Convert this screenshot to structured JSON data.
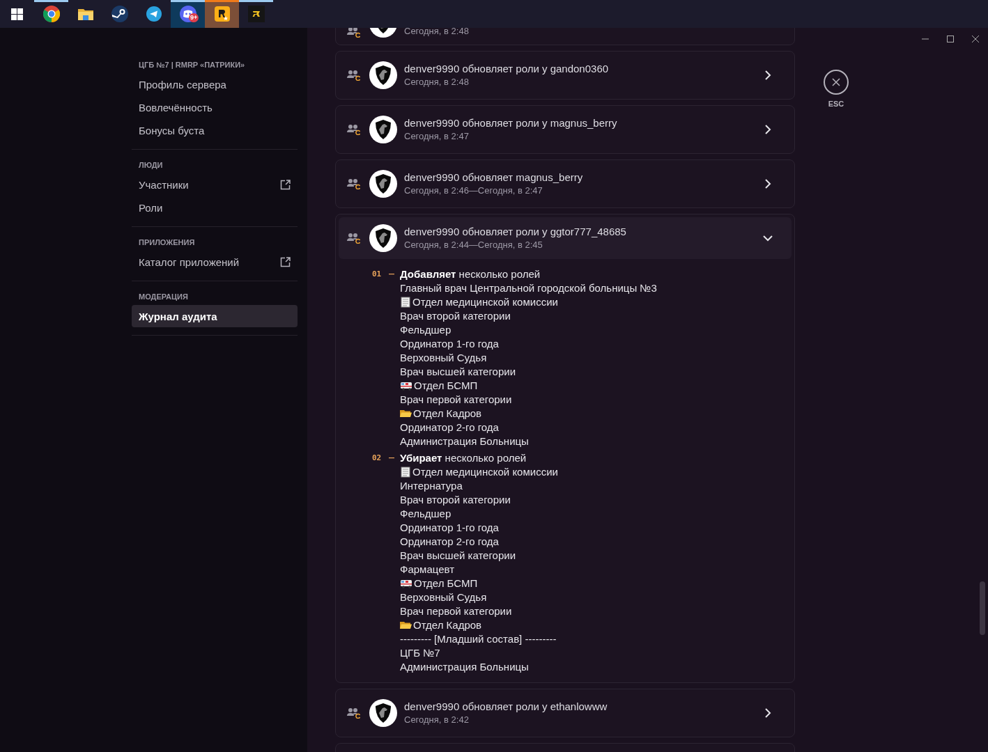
{
  "taskbar": {
    "apps": [
      {
        "kind": "windows",
        "open": false,
        "selected": false
      },
      {
        "kind": "chrome",
        "open": true,
        "selected": false
      },
      {
        "kind": "folder",
        "open": false,
        "selected": false
      },
      {
        "kind": "steam",
        "open": false,
        "selected": false
      },
      {
        "kind": "telegram",
        "open": false,
        "selected": false
      },
      {
        "kind": "discord",
        "open": true,
        "selected": true,
        "badge": "9+"
      },
      {
        "kind": "rockstar",
        "open": true,
        "selected": true
      },
      {
        "kind": "r-app",
        "open": true,
        "selected": false
      }
    ]
  },
  "sidebar": {
    "sections": [
      {
        "header": "ЦГБ №7 | RMRP «ПАТРИКИ»",
        "items": [
          {
            "label": "Профиль сервера",
            "selected": false,
            "external": false
          },
          {
            "label": "Вовлечённость",
            "selected": false,
            "external": false
          },
          {
            "label": "Бонусы буста",
            "selected": false,
            "external": false
          }
        ]
      },
      {
        "header": "ЛЮДИ",
        "items": [
          {
            "label": "Участники",
            "selected": false,
            "external": true
          },
          {
            "label": "Роли",
            "selected": false,
            "external": false
          }
        ]
      },
      {
        "header": "ПРИЛОЖЕНИЯ",
        "items": [
          {
            "label": "Каталог приложений",
            "selected": false,
            "external": true
          }
        ]
      },
      {
        "header": "МОДЕРАЦИЯ",
        "items": [
          {
            "label": "Журнал аудита",
            "selected": true,
            "external": false
          }
        ]
      }
    ]
  },
  "audit_log": {
    "entries": [
      {
        "time": "Сегодня, в 2:48"
      },
      {
        "title": "denver9990 обновляет роли у gandon0360",
        "time": "Сегодня, в 2:48",
        "expanded": false
      },
      {
        "title": "denver9990 обновляет роли у magnus_berry",
        "time": "Сегодня, в 2:47",
        "expanded": false
      },
      {
        "title": "denver9990 обновляет magnus_berry",
        "time": "Сегодня, в 2:46—Сегодня, в 2:47",
        "expanded": false
      },
      {
        "title": "denver9990 обновляет роли у ggtor777_48685",
        "time": "Сегодня, в 2:44—Сегодня, в 2:45",
        "expanded": true,
        "changes": [
          {
            "number": "01",
            "action": "**Добавляет** несколько ролей",
            "roles": [
              {
                "name": "Главный врач Центральной городской больницы №3",
                "kind": "plain"
              },
              {
                "name": "Отдел медицинской комиссии",
                "kind": "document"
              },
              {
                "name": "Врач второй категории",
                "kind": "plain"
              },
              {
                "name": "Фельдшер",
                "kind": "plain"
              },
              {
                "name": "Ординатор 1-го года",
                "kind": "plain"
              },
              {
                "name": "Верховный Судья",
                "kind": "plain"
              },
              {
                "name": "Врач высшей категории",
                "kind": "plain"
              },
              {
                "name": "Отдел БСМП",
                "kind": "ambulance"
              },
              {
                "name": "Врач первой категории",
                "kind": "plain"
              },
              {
                "name": "Отдел Кадров",
                "kind": "folder"
              },
              {
                "name": "Ординатор 2-го года",
                "kind": "plain"
              },
              {
                "name": "Администрация Больницы",
                "kind": "plain"
              }
            ]
          },
          {
            "number": "02",
            "action": "**Убирает** несколько ролей",
            "roles": [
              {
                "name": "Отдел медицинской комиссии",
                "kind": "document"
              },
              {
                "name": "Интернатура",
                "kind": "plain"
              },
              {
                "name": "Врач второй категории",
                "kind": "plain"
              },
              {
                "name": "Фельдшер",
                "kind": "plain"
              },
              {
                "name": "Ординатор 1-го года",
                "kind": "plain"
              },
              {
                "name": "Ординатор 2-го года",
                "kind": "plain"
              },
              {
                "name": "Врач высшей категории",
                "kind": "plain"
              },
              {
                "name": "Фармацевт",
                "kind": "plain"
              },
              {
                "name": "Отдел БСМП",
                "kind": "ambulance"
              },
              {
                "name": "Верховный Судья",
                "kind": "plain"
              },
              {
                "name": "Врач первой категории",
                "kind": "plain"
              },
              {
                "name": "Отдел Кадров",
                "kind": "folder"
              },
              {
                "name": "--------- [Младший состав] ---------",
                "kind": "plain"
              },
              {
                "name": "ЦГБ №7",
                "kind": "plain"
              },
              {
                "name": "Администрация Больницы",
                "kind": "plain"
              }
            ]
          }
        ]
      },
      {
        "title": "denver9990 обновляет роли у ethanlowww",
        "time": "Сегодня, в 2:42",
        "expanded": false
      }
    ],
    "more_below": true
  },
  "close_button": {
    "label": "ESC"
  }
}
